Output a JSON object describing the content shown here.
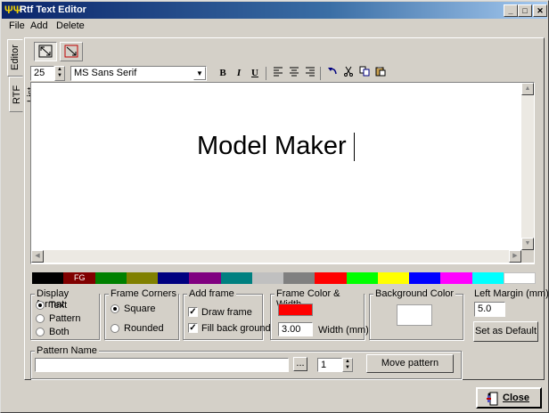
{
  "window": {
    "title": "Rtf Text Editor"
  },
  "menu": [
    "File",
    "Add",
    "Delete"
  ],
  "side_tabs": {
    "editor": "Editor",
    "rtf_list": "RTF List"
  },
  "toolbar": {
    "font_size": "25",
    "font_name": "MS Sans Serif",
    "bold": "B",
    "italic": "I",
    "underline": "U"
  },
  "editor": {
    "text": "Model Maker"
  },
  "color_strip": {
    "fg_label": "FG",
    "colors": [
      "#000000",
      "#800000",
      "#008000",
      "#808000",
      "#000080",
      "#800080",
      "#008080",
      "#c0c0c0",
      "#808080",
      "#ff0000",
      "#00ff00",
      "#ffff00",
      "#0000ff",
      "#ff00ff",
      "#00ffff",
      "#ffffff"
    ]
  },
  "display_format": {
    "title": "Display format",
    "options": [
      "Text",
      "Pattern",
      "Both"
    ],
    "selected": "Text"
  },
  "frame_corners": {
    "title": "Frame Corners",
    "options": [
      "Square",
      "Rounded"
    ],
    "selected": "Square"
  },
  "add_frame": {
    "title": "Add frame",
    "draw_frame": "Draw frame",
    "fill_background": "Fill back ground"
  },
  "frame_color": {
    "title": "Frame Color & Width",
    "color": "#ff0000",
    "width_value": "3.00",
    "width_label": "Width (mm)"
  },
  "background_color": {
    "title": "Background Color",
    "color": "#ffffff"
  },
  "left_margin": {
    "label": "Left Margin (mm)",
    "value": "5.0",
    "default_button": "Set as Default"
  },
  "pattern": {
    "title": "Pattern Name",
    "value": "",
    "browse": "...",
    "spin_value": "1",
    "move_button": "Move pattern"
  },
  "close_button": "Close"
}
